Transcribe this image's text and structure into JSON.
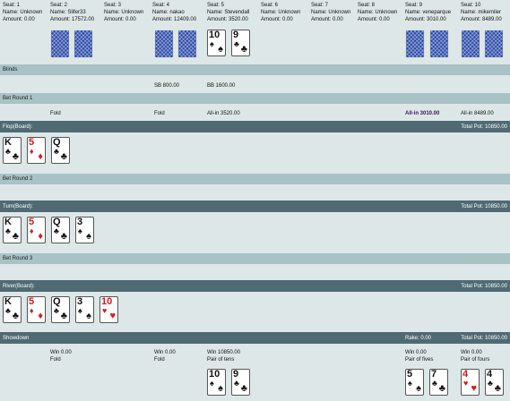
{
  "seats": [
    {
      "seat": "Seat: 1",
      "name": "Name: Unknown",
      "amount": "Amount: 0.00"
    },
    {
      "seat": "Seat: 2",
      "name": "Name: Slifer33",
      "amount": "Amount: 17572.00"
    },
    {
      "seat": "Seat: 3",
      "name": "Name: Unknown",
      "amount": "Amount: 0.00"
    },
    {
      "seat": "Seat: 4",
      "name": "Name: nakao",
      "amount": "Amount: 12409.00"
    },
    {
      "seat": "Seat: 5",
      "name": "Name: Stevendall",
      "amount": "Amount: 3520.00"
    },
    {
      "seat": "Seat: 6",
      "name": "Name: Unknown",
      "amount": "Amount: 0.00"
    },
    {
      "seat": "Seat: 7",
      "name": "Name: Unknown",
      "amount": "Amount: 0.00"
    },
    {
      "seat": "Seat: 8",
      "name": "Name: Unknown",
      "amount": "Amount: 0.00"
    },
    {
      "seat": "Seat: 9",
      "name": "Name: veneparque",
      "amount": "Amount: 3010.00"
    },
    {
      "seat": "Seat: 10",
      "name": "Name: mikemiler",
      "amount": "Amount: 8489.00"
    }
  ],
  "sections": {
    "blinds": "Blinds",
    "bet_round_1": "Bet Round 1",
    "flop": "Flop(Board):",
    "bet_round_2": "Bet Round 2",
    "turn": "Turn(Board):",
    "bet_round_3": "Bet Round 3",
    "river": "River(Board):",
    "showdown": "Showdown"
  },
  "total_pot": "Total Pot: 10850.00",
  "rake": "Rake: 0.00",
  "blinds": {
    "sb": "SB 800.00",
    "bb": "BB 1600.00"
  },
  "round1": {
    "seat2": "Fold",
    "seat4": "Fold",
    "seat5": "All-in 3520.00",
    "seat9": "All-in 3010.00",
    "seat10": "All-in 8489.00"
  },
  "showdown": {
    "seat2_win": "Win 0.00",
    "seat2_action": "Fold",
    "seat4_win": "Win 0.00",
    "seat4_action": "Fold",
    "seat5_win": "Win 10850.00",
    "seat5_hand": "Pair of tens",
    "seat9_win": "Win 0.00",
    "seat9_hand": "Pair of fives",
    "seat10_win": "Win 0.00",
    "seat10_hand": "Pair of fours"
  },
  "cards": {
    "seat5_hole": [
      {
        "rank": "10",
        "suit": "♠"
      },
      {
        "rank": "9",
        "suit": "♣"
      }
    ],
    "board": [
      {
        "rank": "K",
        "suit": "♣"
      },
      {
        "rank": "5",
        "suit": "♦"
      },
      {
        "rank": "Q",
        "suit": "♣"
      },
      {
        "rank": "3",
        "suit": "♠"
      },
      {
        "rank": "10",
        "suit": "♥"
      }
    ],
    "seat9_hole": [
      {
        "rank": "5",
        "suit": "♠"
      },
      {
        "rank": "7",
        "suit": "♣"
      }
    ],
    "seat10_hole": [
      {
        "rank": "4",
        "suit": "♥"
      },
      {
        "rank": "4",
        "suit": "♣"
      }
    ]
  },
  "colors": {
    "dark_bar": "#4f6a72",
    "light_bar": "#a8c2c6",
    "background": "#dde7e7",
    "card_back": "#2a4aa8",
    "red_suit": "#d81818"
  }
}
